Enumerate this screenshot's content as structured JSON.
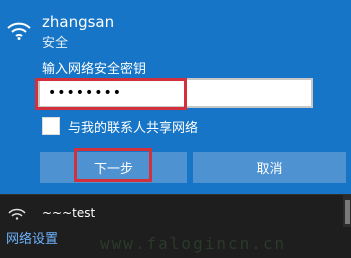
{
  "network": {
    "ssid": "zhangsan",
    "security": "安全",
    "password_label": "输入网络安全密钥",
    "password_value": "••••••••",
    "share_label": "与我的联系人共享网络",
    "share_checked": false,
    "next_label": "下一步",
    "cancel_label": "取消"
  },
  "other_network": {
    "name": "~~~test"
  },
  "footer": {
    "settings_link": "网络设置"
  },
  "watermark": "www.falogincn.cn",
  "icons": {
    "wifi": "wifi-signal-icon",
    "second_network": "wifi-signal-icon"
  },
  "colors": {
    "panel": "#1675c7",
    "button": "#4f92d2",
    "highlight": "#d2303a",
    "link": "#6fb3ff",
    "background": "#1e1e1e"
  }
}
